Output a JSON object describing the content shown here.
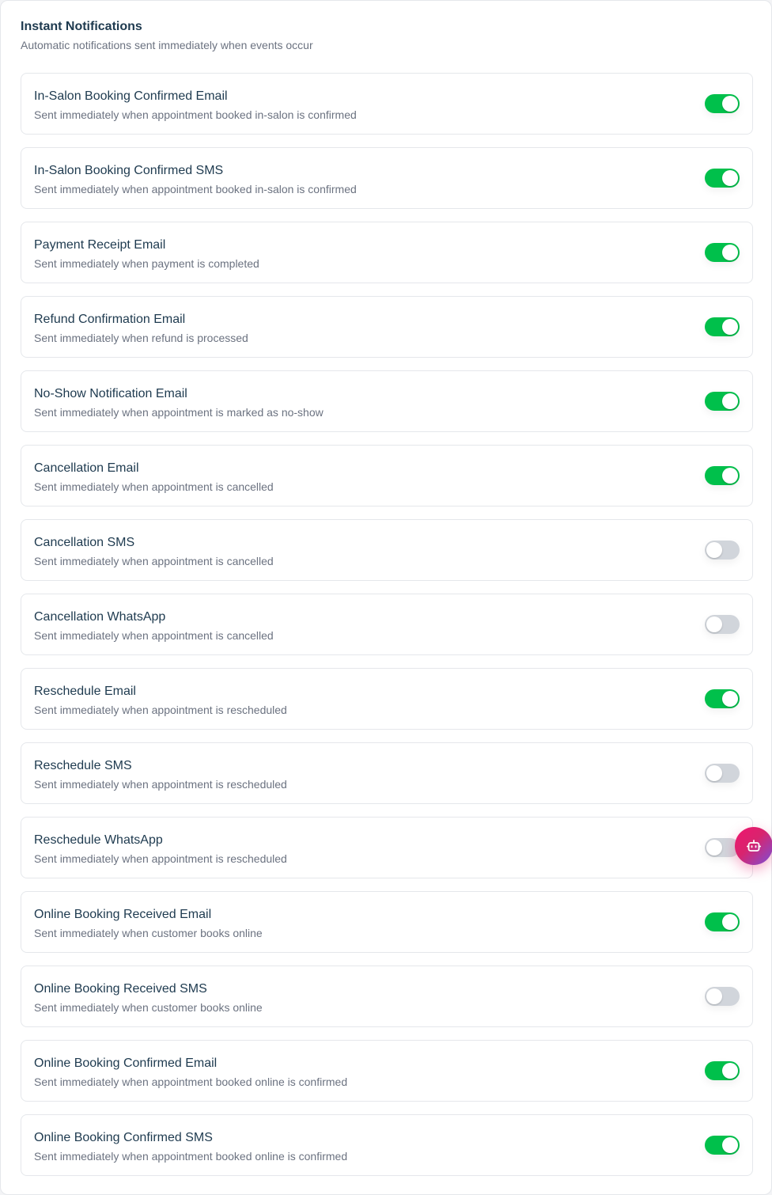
{
  "section": {
    "title": "Instant Notifications",
    "subtitle": "Automatic notifications sent immediately when events occur"
  },
  "notifications": [
    {
      "title": "In-Salon Booking Confirmed Email",
      "description": "Sent immediately when appointment booked in-salon is confirmed",
      "enabled": true
    },
    {
      "title": "In-Salon Booking Confirmed SMS",
      "description": "Sent immediately when appointment booked in-salon is confirmed",
      "enabled": true
    },
    {
      "title": "Payment Receipt Email",
      "description": "Sent immediately when payment is completed",
      "enabled": true
    },
    {
      "title": "Refund Confirmation Email",
      "description": "Sent immediately when refund is processed",
      "enabled": true
    },
    {
      "title": "No-Show Notification Email",
      "description": "Sent immediately when appointment is marked as no-show",
      "enabled": true
    },
    {
      "title": "Cancellation Email",
      "description": "Sent immediately when appointment is cancelled",
      "enabled": true
    },
    {
      "title": "Cancellation SMS",
      "description": "Sent immediately when appointment is cancelled",
      "enabled": false
    },
    {
      "title": "Cancellation WhatsApp",
      "description": "Sent immediately when appointment is cancelled",
      "enabled": false
    },
    {
      "title": "Reschedule Email",
      "description": "Sent immediately when appointment is rescheduled",
      "enabled": true
    },
    {
      "title": "Reschedule SMS",
      "description": "Sent immediately when appointment is rescheduled",
      "enabled": false
    },
    {
      "title": "Reschedule WhatsApp",
      "description": "Sent immediately when appointment is rescheduled",
      "enabled": false
    },
    {
      "title": "Online Booking Received Email",
      "description": "Sent immediately when customer books online",
      "enabled": true
    },
    {
      "title": "Online Booking Received SMS",
      "description": "Sent immediately when customer books online",
      "enabled": false
    },
    {
      "title": "Online Booking Confirmed Email",
      "description": "Sent immediately when appointment booked online is confirmed",
      "enabled": true
    },
    {
      "title": "Online Booking Confirmed SMS",
      "description": "Sent immediately when appointment booked online is confirmed",
      "enabled": true
    }
  ],
  "colors": {
    "toggle_on": "#00c04b",
    "toggle_off": "#d1d5db",
    "title_text": "#1e3a4f",
    "muted_text": "#6b7280"
  },
  "assistant_button": {
    "icon": "robot-icon"
  }
}
